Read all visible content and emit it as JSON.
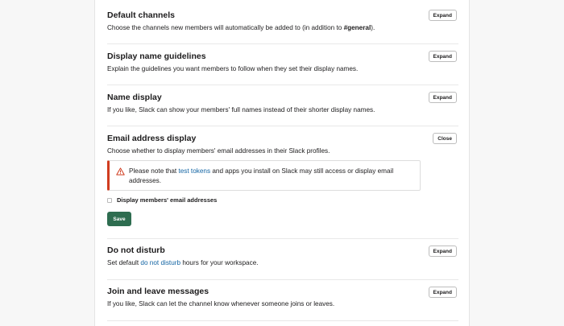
{
  "sections": [
    {
      "title": "Default channels",
      "desc_before": "Choose the channels new members will automatically be added to (in addition to ",
      "desc_bold": "#general",
      "desc_after": ").",
      "button": "Expand"
    },
    {
      "title": "Display name guidelines",
      "desc": "Explain the guidelines you want members to follow when they set their display names.",
      "button": "Expand"
    },
    {
      "title": "Name display",
      "desc": "If you like, Slack can show your members' full names instead of their shorter display names.",
      "button": "Expand"
    },
    {
      "title": "Email address display",
      "desc": "Choose whether to display members' email addresses in their Slack profiles.",
      "button": "Close",
      "notice": {
        "before": "Please note that ",
        "link": "test tokens",
        "after": " and apps you install on Slack may still access or display email addresses."
      },
      "checkbox_label": "Display members' email addresses",
      "checkbox_checked": false,
      "save_label": "Save"
    },
    {
      "title": "Do not disturb",
      "desc_before": "Set default ",
      "desc_link": "do not disturb",
      "desc_after": " hours for your workspace.",
      "button": "Expand"
    },
    {
      "title": "Join and leave messages",
      "desc": "If you like, Slack can let the channel know whenever someone joins or leaves.",
      "button": "Expand"
    }
  ],
  "colors": {
    "save_button": "#2e6d50",
    "link": "#1264a3",
    "warning": "#d03c1f"
  },
  "icons": {
    "notice": "warning-triangle-icon"
  }
}
